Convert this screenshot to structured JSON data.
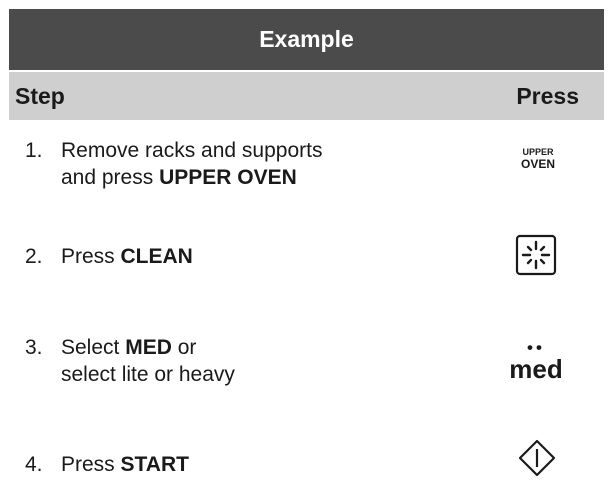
{
  "title": "Example",
  "header": {
    "step_label": "Step",
    "press_label": "Press"
  },
  "steps": [
    {
      "num": "1.",
      "line1_pre": "Remove racks and supports",
      "line2_pre": "and press ",
      "line2_bold": "UPPER OVEN"
    },
    {
      "num": "2.",
      "pre": "Press ",
      "bold": "CLEAN"
    },
    {
      "num": "3.",
      "line1_pre": "Select ",
      "line1_bold": "MED",
      "line1_post": " or",
      "line2": "select lite or heavy"
    },
    {
      "num": "4.",
      "pre": "Press ",
      "bold": "START"
    }
  ],
  "keys": {
    "upper_oven_line1": "UPPER",
    "upper_oven_line2": "OVEN",
    "clean_icon": "clean-sparkle-icon",
    "med_dots": "••",
    "med_label": "med",
    "start_icon": "start-diamond-icon"
  }
}
